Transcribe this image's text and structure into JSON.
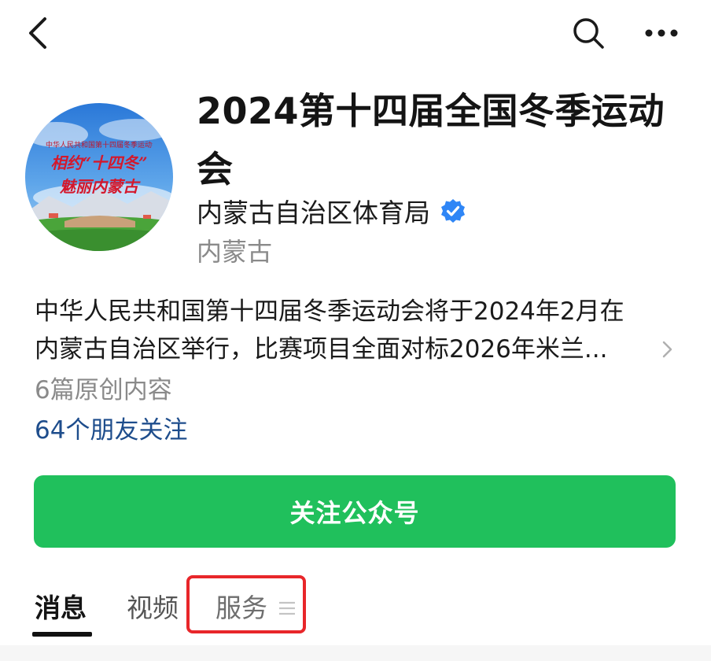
{
  "account": {
    "title": "2024第十四届全国冬季运动会",
    "org_name": "内蒙古自治区体育局",
    "region": "内蒙古",
    "avatar_text_line1": "中华人民共和国第十四届冬季运动会",
    "avatar_text_line2": "相约“十四冬”",
    "avatar_text_line3": "魅丽内蒙古"
  },
  "description": {
    "line1": "中华人民共和国第十四届冬季运动会将于2024年2月在",
    "line2": "内蒙古自治区举行，比赛项目全面对标2026年米兰..."
  },
  "stats": {
    "article_count": "6篇原创内容",
    "friends_follow": "64个朋友关注"
  },
  "follow_button": {
    "label": "关注公众号"
  },
  "tabs": [
    {
      "label": "消息",
      "selected": true
    },
    {
      "label": "视频",
      "selected": false
    },
    {
      "label": "服务",
      "selected": false
    }
  ],
  "icons": {
    "back": "chevron-left-icon",
    "search": "search-icon",
    "more": "more-dots-icon",
    "verified": "verified-badge-icon",
    "menu": "menu-lines-icon",
    "expand": "chevron-right-icon"
  },
  "colors": {
    "primary_green": "#20c05c",
    "link_blue": "#1e4d8c",
    "verified_blue": "#2f86f6",
    "highlight_red": "#e8262a",
    "secondary_text": "#8a8a8a"
  }
}
